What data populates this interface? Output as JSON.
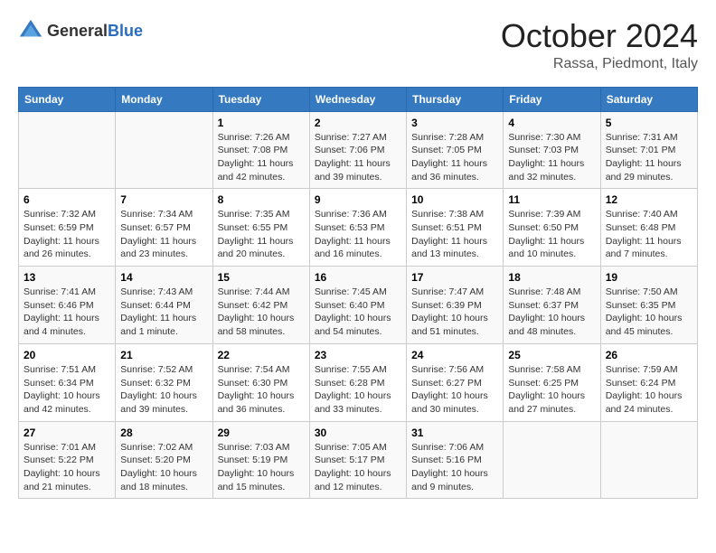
{
  "header": {
    "logo_general": "General",
    "logo_blue": "Blue",
    "month": "October 2024",
    "location": "Rassa, Piedmont, Italy"
  },
  "days_of_week": [
    "Sunday",
    "Monday",
    "Tuesday",
    "Wednesday",
    "Thursday",
    "Friday",
    "Saturday"
  ],
  "weeks": [
    [
      {
        "day": "",
        "sunrise": "",
        "sunset": "",
        "daylight": ""
      },
      {
        "day": "",
        "sunrise": "",
        "sunset": "",
        "daylight": ""
      },
      {
        "day": "1",
        "sunrise": "Sunrise: 7:26 AM",
        "sunset": "Sunset: 7:08 PM",
        "daylight": "Daylight: 11 hours and 42 minutes."
      },
      {
        "day": "2",
        "sunrise": "Sunrise: 7:27 AM",
        "sunset": "Sunset: 7:06 PM",
        "daylight": "Daylight: 11 hours and 39 minutes."
      },
      {
        "day": "3",
        "sunrise": "Sunrise: 7:28 AM",
        "sunset": "Sunset: 7:05 PM",
        "daylight": "Daylight: 11 hours and 36 minutes."
      },
      {
        "day": "4",
        "sunrise": "Sunrise: 7:30 AM",
        "sunset": "Sunset: 7:03 PM",
        "daylight": "Daylight: 11 hours and 32 minutes."
      },
      {
        "day": "5",
        "sunrise": "Sunrise: 7:31 AM",
        "sunset": "Sunset: 7:01 PM",
        "daylight": "Daylight: 11 hours and 29 minutes."
      }
    ],
    [
      {
        "day": "6",
        "sunrise": "Sunrise: 7:32 AM",
        "sunset": "Sunset: 6:59 PM",
        "daylight": "Daylight: 11 hours and 26 minutes."
      },
      {
        "day": "7",
        "sunrise": "Sunrise: 7:34 AM",
        "sunset": "Sunset: 6:57 PM",
        "daylight": "Daylight: 11 hours and 23 minutes."
      },
      {
        "day": "8",
        "sunrise": "Sunrise: 7:35 AM",
        "sunset": "Sunset: 6:55 PM",
        "daylight": "Daylight: 11 hours and 20 minutes."
      },
      {
        "day": "9",
        "sunrise": "Sunrise: 7:36 AM",
        "sunset": "Sunset: 6:53 PM",
        "daylight": "Daylight: 11 hours and 16 minutes."
      },
      {
        "day": "10",
        "sunrise": "Sunrise: 7:38 AM",
        "sunset": "Sunset: 6:51 PM",
        "daylight": "Daylight: 11 hours and 13 minutes."
      },
      {
        "day": "11",
        "sunrise": "Sunrise: 7:39 AM",
        "sunset": "Sunset: 6:50 PM",
        "daylight": "Daylight: 11 hours and 10 minutes."
      },
      {
        "day": "12",
        "sunrise": "Sunrise: 7:40 AM",
        "sunset": "Sunset: 6:48 PM",
        "daylight": "Daylight: 11 hours and 7 minutes."
      }
    ],
    [
      {
        "day": "13",
        "sunrise": "Sunrise: 7:41 AM",
        "sunset": "Sunset: 6:46 PM",
        "daylight": "Daylight: 11 hours and 4 minutes."
      },
      {
        "day": "14",
        "sunrise": "Sunrise: 7:43 AM",
        "sunset": "Sunset: 6:44 PM",
        "daylight": "Daylight: 11 hours and 1 minute."
      },
      {
        "day": "15",
        "sunrise": "Sunrise: 7:44 AM",
        "sunset": "Sunset: 6:42 PM",
        "daylight": "Daylight: 10 hours and 58 minutes."
      },
      {
        "day": "16",
        "sunrise": "Sunrise: 7:45 AM",
        "sunset": "Sunset: 6:40 PM",
        "daylight": "Daylight: 10 hours and 54 minutes."
      },
      {
        "day": "17",
        "sunrise": "Sunrise: 7:47 AM",
        "sunset": "Sunset: 6:39 PM",
        "daylight": "Daylight: 10 hours and 51 minutes."
      },
      {
        "day": "18",
        "sunrise": "Sunrise: 7:48 AM",
        "sunset": "Sunset: 6:37 PM",
        "daylight": "Daylight: 10 hours and 48 minutes."
      },
      {
        "day": "19",
        "sunrise": "Sunrise: 7:50 AM",
        "sunset": "Sunset: 6:35 PM",
        "daylight": "Daylight: 10 hours and 45 minutes."
      }
    ],
    [
      {
        "day": "20",
        "sunrise": "Sunrise: 7:51 AM",
        "sunset": "Sunset: 6:34 PM",
        "daylight": "Daylight: 10 hours and 42 minutes."
      },
      {
        "day": "21",
        "sunrise": "Sunrise: 7:52 AM",
        "sunset": "Sunset: 6:32 PM",
        "daylight": "Daylight: 10 hours and 39 minutes."
      },
      {
        "day": "22",
        "sunrise": "Sunrise: 7:54 AM",
        "sunset": "Sunset: 6:30 PM",
        "daylight": "Daylight: 10 hours and 36 minutes."
      },
      {
        "day": "23",
        "sunrise": "Sunrise: 7:55 AM",
        "sunset": "Sunset: 6:28 PM",
        "daylight": "Daylight: 10 hours and 33 minutes."
      },
      {
        "day": "24",
        "sunrise": "Sunrise: 7:56 AM",
        "sunset": "Sunset: 6:27 PM",
        "daylight": "Daylight: 10 hours and 30 minutes."
      },
      {
        "day": "25",
        "sunrise": "Sunrise: 7:58 AM",
        "sunset": "Sunset: 6:25 PM",
        "daylight": "Daylight: 10 hours and 27 minutes."
      },
      {
        "day": "26",
        "sunrise": "Sunrise: 7:59 AM",
        "sunset": "Sunset: 6:24 PM",
        "daylight": "Daylight: 10 hours and 24 minutes."
      }
    ],
    [
      {
        "day": "27",
        "sunrise": "Sunrise: 7:01 AM",
        "sunset": "Sunset: 5:22 PM",
        "daylight": "Daylight: 10 hours and 21 minutes."
      },
      {
        "day": "28",
        "sunrise": "Sunrise: 7:02 AM",
        "sunset": "Sunset: 5:20 PM",
        "daylight": "Daylight: 10 hours and 18 minutes."
      },
      {
        "day": "29",
        "sunrise": "Sunrise: 7:03 AM",
        "sunset": "Sunset: 5:19 PM",
        "daylight": "Daylight: 10 hours and 15 minutes."
      },
      {
        "day": "30",
        "sunrise": "Sunrise: 7:05 AM",
        "sunset": "Sunset: 5:17 PM",
        "daylight": "Daylight: 10 hours and 12 minutes."
      },
      {
        "day": "31",
        "sunrise": "Sunrise: 7:06 AM",
        "sunset": "Sunset: 5:16 PM",
        "daylight": "Daylight: 10 hours and 9 minutes."
      },
      {
        "day": "",
        "sunrise": "",
        "sunset": "",
        "daylight": ""
      },
      {
        "day": "",
        "sunrise": "",
        "sunset": "",
        "daylight": ""
      }
    ]
  ]
}
